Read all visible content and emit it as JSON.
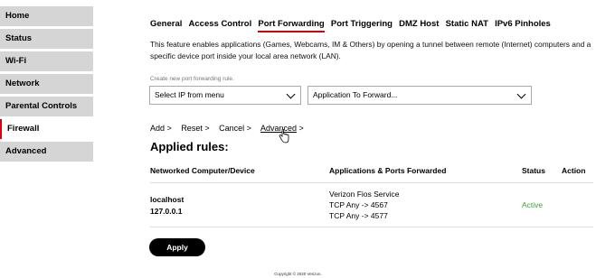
{
  "sidebar": {
    "items": [
      {
        "label": "Home"
      },
      {
        "label": "Status"
      },
      {
        "label": "Wi-Fi"
      },
      {
        "label": "Network"
      },
      {
        "label": "Parental Controls"
      },
      {
        "label": "Firewall",
        "active": true
      },
      {
        "label": "Advanced"
      }
    ]
  },
  "tabs": [
    {
      "label": "General"
    },
    {
      "label": "Access Control"
    },
    {
      "label": "Port Forwarding",
      "active": true
    },
    {
      "label": "Port Triggering"
    },
    {
      "label": "DMZ Host"
    },
    {
      "label": "Static NAT"
    },
    {
      "label": "IPv6 Pinholes"
    }
  ],
  "description": "This feature enables applications (Games, Webcams, IM & Others) by opening a tunnel between remote (Internet) computers and a specific device port inside your local area network (LAN).",
  "create_rule": {
    "label": "Create new port forwarding rule.",
    "ip_select": "Select IP from menu",
    "app_select": "Application To Forward..."
  },
  "actions": {
    "add": "Add",
    "reset": "Reset",
    "cancel": "Cancel",
    "advanced": "Advanced",
    "chevron": ">"
  },
  "applied_title": "Applied rules:",
  "table": {
    "headers": {
      "device": "Networked Computer/Device",
      "apps": "Applications & Ports Forwarded",
      "status": "Status",
      "action": "Action"
    },
    "rows": [
      {
        "device_name": "localhost",
        "device_ip": "127.0.0.1",
        "apps": [
          "Verizon Fios Service",
          "TCP Any -> 4567",
          "TCP Any -> 4577"
        ],
        "status": "Active"
      }
    ]
  },
  "apply_label": "Apply",
  "copyright": "Copyright © 2020 Verizon.",
  "colors": {
    "accent": "#cd040b",
    "active_status": "#3aa53a",
    "sidebar_bg": "#d5d5d5"
  }
}
